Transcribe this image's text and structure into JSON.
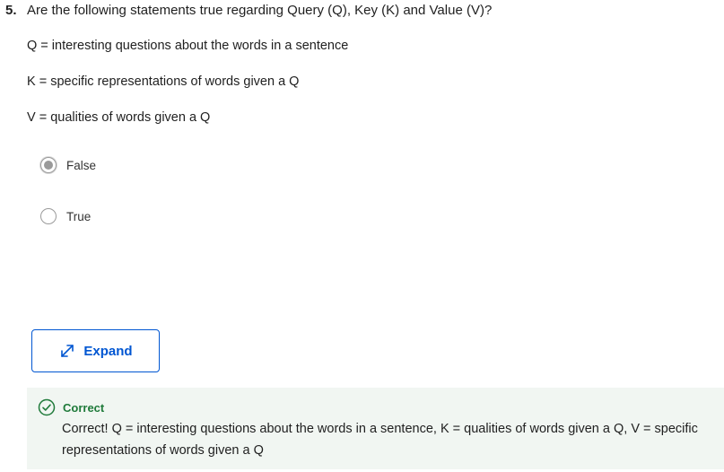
{
  "question": {
    "number": "5.",
    "text": "Are the following statements true regarding Query (Q), Key (K) and Value (V)?",
    "statements": [
      "Q = interesting questions about the words in a sentence",
      "K = specific representations of words given a Q",
      "V = qualities of words given a Q"
    ]
  },
  "options": [
    {
      "label": "False",
      "selected": true
    },
    {
      "label": "True",
      "selected": false
    }
  ],
  "expand_button": {
    "label": "Expand",
    "icon": "expand-arrows-icon"
  },
  "feedback": {
    "status": "Correct",
    "message": "Correct! Q = interesting questions about the words in a sentence, K = qualities of words given a Q, V = specific representations of words given a Q",
    "icon": "check-circle-icon"
  },
  "colors": {
    "accent": "#0056d2",
    "success": "#1f7a3a",
    "feedback_bg": "#f1f6f2",
    "radio_gray": "#9a9a9a"
  }
}
